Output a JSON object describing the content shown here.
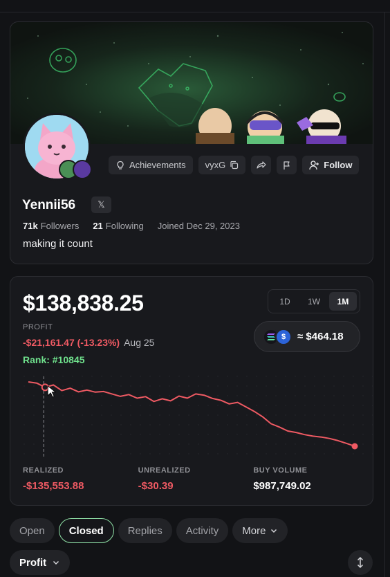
{
  "profile": {
    "username": "Yennii56",
    "x_label": "𝕏",
    "followers_count": "71k",
    "followers_label": "Followers",
    "following_count": "21",
    "following_label": "Following",
    "joined": "Joined Dec 29, 2023",
    "bio": "making it count",
    "actions": {
      "achievements": "Achievements",
      "referral_code": "vyxG",
      "follow": "Follow"
    }
  },
  "pnl": {
    "balance": "$138,838.25",
    "timeframes": [
      "1D",
      "1W",
      "1M"
    ],
    "active_timeframe": "1M",
    "profit_label": "PROFIT",
    "profit_value": "-$21,161.47 (-13.23%)",
    "profit_date": "Aug 25",
    "rank": "Rank: #10845",
    "sol_value": "≈ $464.18",
    "metrics": [
      {
        "label": "REALIZED",
        "value": "-$135,553.88"
      },
      {
        "label": "UNREALIZED",
        "value": "-$30.39"
      },
      {
        "label": "BUY VOLUME",
        "value": "$987,749.02"
      }
    ]
  },
  "chart_data": {
    "type": "line",
    "title": "",
    "xlabel": "",
    "ylabel": "",
    "grid": true,
    "series": [
      {
        "values": [
          160200,
          159800,
          158400,
          159200,
          157300,
          158100,
          156900,
          157500,
          156800,
          157000,
          156200,
          155400,
          156000,
          154800,
          155300,
          153700,
          154600,
          153900,
          155500,
          154800,
          156200,
          155800,
          154700,
          154100,
          152900,
          153400,
          151900,
          150400,
          148600,
          146300,
          145200,
          143900,
          143400,
          142700,
          142200,
          141900,
          141400,
          140700,
          139800,
          138838
        ]
      }
    ],
    "marker_index": 2
  },
  "tabs": {
    "items": [
      "Open",
      "Closed",
      "Replies",
      "Activity",
      "More"
    ],
    "active": "Closed",
    "sort_label": "Profit"
  },
  "colors": {
    "accent_green": "#8fe0a6",
    "loss_red": "#ef5a63",
    "rank_green": "#6fe08c"
  }
}
